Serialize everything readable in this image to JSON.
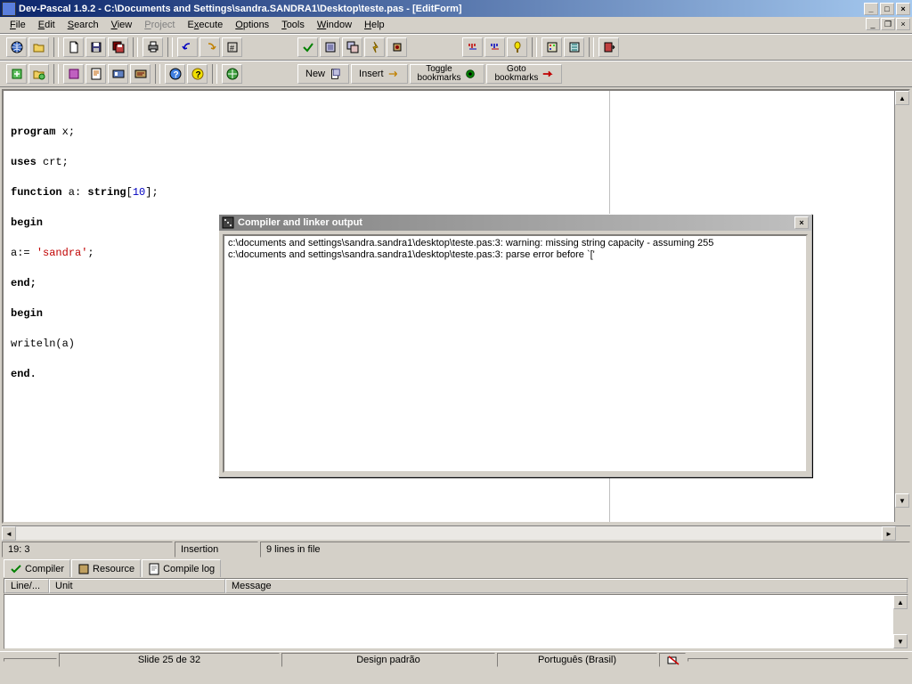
{
  "window": {
    "title": "Dev-Pascal 1.9.2 - C:\\Documents and Settings\\sandra.SANDRA1\\Desktop\\teste.pas - [EditForm]"
  },
  "menu": {
    "file": "File",
    "edit": "Edit",
    "search": "Search",
    "view": "View",
    "project": "Project",
    "execute": "Execute",
    "options": "Options",
    "tools": "Tools",
    "window": "Window",
    "help": "Help"
  },
  "toolbar2": {
    "new": "New",
    "insert": "Insert",
    "toggle": "Toggle\nbookmarks",
    "goto": "Goto\nbookmarks"
  },
  "code": {
    "l1a": "program",
    "l1b": " x;",
    "l2a": "uses",
    "l2b": " crt;",
    "l3a": "function",
    "l3b": " a: ",
    "l3c": "string",
    "l3d": "[",
    "l3e": "10",
    "l3f": "];",
    "l4": "begin",
    "l5a": "a:= ",
    "l5b": "'sandra'",
    "l5c": ";",
    "l6": "end;",
    "l7": "begin",
    "l8": "writeln(a)",
    "l9": "end."
  },
  "status": {
    "pos": "19: 3",
    "mode": "Insertion",
    "lines": "9 lines in file"
  },
  "tabs": {
    "compiler": "Compiler",
    "resource": "Resource",
    "compilelog": "Compile log"
  },
  "grid": {
    "line": "Line/...",
    "unit": "Unit",
    "message": "Message"
  },
  "output": {
    "title": "Compiler and linker output",
    "line1": "c:\\documents and settings\\sandra.sandra1\\desktop\\teste.pas:3: warning: missing string capacity - assuming 255",
    "line2": "c:\\documents and settings\\sandra.sandra1\\desktop\\teste.pas:3: parse error before `['"
  },
  "bottom": {
    "slide": "Slide 25 de 32",
    "design": "Design padrão",
    "lang": "Português (Brasil)"
  }
}
